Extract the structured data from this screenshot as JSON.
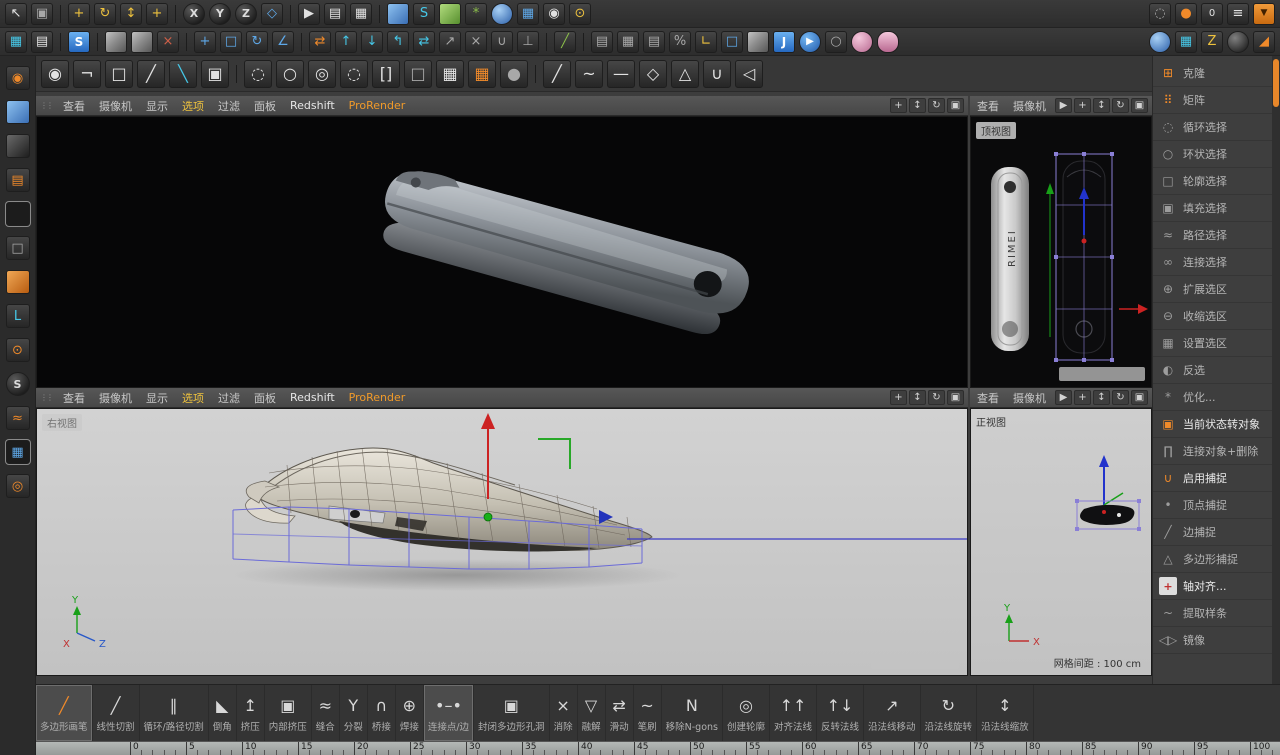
{
  "colors": {
    "accent_orange": "#e8872a",
    "menu_highlight": "#eec23e",
    "prorender_orange": "#f09a2a",
    "cage_purple": "#8a7fd6",
    "axis_red": "#cc2222",
    "axis_green": "#18a018",
    "axis_blue": "#2233cc"
  },
  "toolbars": {
    "row1": [
      {
        "n": "live-selection-icon",
        "g": "↖",
        "c": "i-light"
      },
      {
        "n": "snapshot-icon",
        "g": "▣",
        "c": "i-gray"
      },
      {
        "s": 1
      },
      {
        "n": "move-tool-icon",
        "g": "+",
        "c": "i-yellow"
      },
      {
        "n": "rotate-tool-icon",
        "g": "↻",
        "c": "i-yellow"
      },
      {
        "n": "scale-tool-icon",
        "g": "↕",
        "c": "i-yellow"
      },
      {
        "n": "last-tool-icon",
        "g": "+",
        "c": "i-yellow"
      },
      {
        "s": 1
      },
      {
        "n": "x-axis-lock-icon",
        "g": "X",
        "c": "i-darkcircle"
      },
      {
        "n": "y-axis-lock-icon",
        "g": "Y",
        "c": "i-darkcircle"
      },
      {
        "n": "z-axis-lock-icon",
        "g": "Z",
        "c": "i-darkcircle"
      },
      {
        "n": "coordinate-system-icon",
        "g": "◇",
        "c": "i-blue"
      },
      {
        "s": 1
      },
      {
        "n": "render-view-icon",
        "g": "▶",
        "c": "i-light"
      },
      {
        "n": "render-region-icon",
        "g": "▤",
        "c": "i-light"
      },
      {
        "n": "render-settings-icon",
        "g": "▦",
        "c": "i-light"
      },
      {
        "s": 1
      },
      {
        "n": "new-material-icon",
        "c": "i-cube-blue"
      },
      {
        "n": "spline-pen-icon",
        "g": "S",
        "c": "i-cyan"
      },
      {
        "n": "surface-pen-icon",
        "c": "i-cube-green"
      },
      {
        "n": "array-object-icon",
        "g": "*",
        "c": "i-green"
      },
      {
        "n": "figure-object-icon",
        "c": "i-sphere-blue"
      },
      {
        "n": "volume-builder-icon",
        "g": "▦",
        "c": "i-blue"
      },
      {
        "n": "camera-object-icon",
        "g": "◉",
        "c": "i-light"
      },
      {
        "n": "light-object-icon",
        "g": "⊙",
        "c": "i-yellow"
      }
    ],
    "row1_right": [
      {
        "n": "interactive-region-icon",
        "g": "◌",
        "c": "i-gray"
      },
      {
        "n": "team-render-icon",
        "g": "●",
        "c": "i-orange"
      },
      {
        "n": "frame-counter",
        "g": "0",
        "c": "i-light i-spin"
      },
      {
        "n": "layer-list-icon",
        "g": "≡",
        "c": "i-light"
      },
      {
        "n": "quick-access-icon",
        "g": "▼",
        "c": "i-orangebg"
      }
    ],
    "row2": [
      {
        "n": "content-browser-icon",
        "g": "▦",
        "c": "i-cyan"
      },
      {
        "n": "console-icon",
        "g": "▤",
        "c": "i-light"
      },
      {
        "s": 1
      },
      {
        "n": "s-plugin-icon",
        "g": "S",
        "c": "i-bluebadge"
      },
      {
        "s": 1
      },
      {
        "n": "cube-object-icon",
        "c": "i-cube-gray"
      },
      {
        "n": "instance-object-icon",
        "c": "i-cube-gray"
      },
      {
        "n": "delete-icon",
        "g": "×",
        "c": "i-red"
      },
      {
        "s": 1
      },
      {
        "n": "move-frame-icon",
        "g": "+",
        "c": "i-blue"
      },
      {
        "n": "frame-selected-icon",
        "g": "□",
        "c": "i-blue"
      },
      {
        "n": "rotate-view-icon",
        "g": "↻",
        "c": "i-blue"
      },
      {
        "n": "protractor-icon",
        "g": "∠",
        "c": "i-blue"
      },
      {
        "s": 1
      },
      {
        "n": "swap-axis-icon",
        "g": "⇄",
        "c": "i-orange"
      },
      {
        "n": "arrange-up-icon",
        "g": "↑",
        "c": "i-cyan"
      },
      {
        "n": "arrange-down-icon",
        "g": "↓",
        "c": "i-cyan"
      },
      {
        "n": "transfer-icon",
        "g": "↰",
        "c": "i-cyan"
      },
      {
        "n": "arrow-pair-icon",
        "g": "⇄",
        "c": "i-cyan"
      },
      {
        "n": "arrow-ne-icon",
        "g": "↗",
        "c": "i-gray"
      },
      {
        "n": "arrow-cross-icon",
        "g": "×",
        "c": "i-gray"
      },
      {
        "n": "snap-small-icon",
        "g": "∪",
        "c": "i-gray"
      },
      {
        "n": "axis-swap-icon",
        "g": "⊥",
        "c": "i-gray"
      },
      {
        "s": 1
      },
      {
        "n": "knife-small-icon",
        "g": "╱",
        "c": "i-green"
      },
      {
        "s": 1
      },
      {
        "n": "layer-a-icon",
        "g": "▤",
        "c": "i-gray"
      },
      {
        "n": "layer-b-icon",
        "g": "▦",
        "c": "i-gray"
      },
      {
        "n": "layer-c-icon",
        "g": "▤",
        "c": "i-gray"
      },
      {
        "n": "percent-icon",
        "g": "%",
        "c": "i-gray"
      },
      {
        "n": "workplane-icon",
        "g": "∟",
        "c": "i-yellow"
      },
      {
        "n": "frame-box-icon",
        "g": "□",
        "c": "i-blue"
      },
      {
        "n": "cube-small-icon",
        "c": "i-cube-gray"
      },
      {
        "n": "jump-icon",
        "g": "J",
        "c": "i-bluebadge"
      },
      {
        "n": "play-icon",
        "g": "▶",
        "c": "i-bluecircle"
      },
      {
        "n": "circle-null-icon",
        "g": "○",
        "c": "i-gray"
      },
      {
        "n": "sphere-pink-icon",
        "c": "i-sphere-pink"
      },
      {
        "n": "capsule-pink-icon",
        "c": "i-capsule-pink"
      }
    ],
    "row2_right": [
      {
        "n": "half-sphere-icon",
        "c": "i-sphere-blue"
      },
      {
        "n": "teal-grid-icon",
        "g": "▦",
        "c": "i-cyan"
      },
      {
        "n": "flash-z-icon",
        "g": "Z",
        "c": "i-yellow"
      },
      {
        "n": "dark-sphere-icon",
        "c": "i-sphere-dark"
      },
      {
        "n": "orange-wedge-icon",
        "g": "◢",
        "c": "i-orange"
      }
    ],
    "row3": [
      {
        "n": "sphere-brush-icon",
        "g": "◉",
        "c": "i-light"
      },
      {
        "n": "hook-tool-icon",
        "g": "¬",
        "c": "i-light"
      },
      {
        "n": "ghost-cube-icon",
        "g": "□",
        "c": "i-light"
      },
      {
        "n": "knife-tool-icon",
        "g": "╱",
        "c": "i-light"
      },
      {
        "n": "pen-tool-icon",
        "g": "╲",
        "c": "i-cyan"
      },
      {
        "n": "scale-cube-icon",
        "g": "▣",
        "c": "i-light"
      },
      {
        "s": 1
      },
      {
        "n": "point-mode-icon",
        "g": "◌",
        "c": "i-light"
      },
      {
        "n": "edge-mode-icon",
        "g": "○",
        "c": "i-light"
      },
      {
        "n": "polygon-mode-icon",
        "g": "◎",
        "c": "i-light"
      },
      {
        "n": "ring-points-icon",
        "g": "◌",
        "c": "i-light"
      },
      {
        "n": "bracket-select-icon",
        "g": "[]",
        "c": "i-light"
      },
      {
        "n": "dotted-box-icon",
        "g": "□",
        "c": "i-gray"
      },
      {
        "n": "grid-select-icon",
        "g": "▦",
        "c": "i-light"
      },
      {
        "n": "grid-uv-icon",
        "g": "▦",
        "c": "i-orange"
      },
      {
        "n": "point-sphere-icon",
        "g": "●",
        "c": "i-gray"
      },
      {
        "s": 1
      },
      {
        "n": "brush-tool-icon",
        "g": "╱",
        "c": "i-light"
      },
      {
        "n": "smooth-tool-icon",
        "g": "~",
        "c": "i-light"
      },
      {
        "n": "cut-tool-icon",
        "g": "—",
        "c": "i-light"
      },
      {
        "n": "cube-3d-icon",
        "g": "◇",
        "c": "i-light"
      },
      {
        "n": "group-tool-icon",
        "g": "△",
        "c": "i-light"
      },
      {
        "n": "magnet-tool-icon",
        "g": "∪",
        "c": "i-light"
      },
      {
        "n": "mirror-tool-icon",
        "g": "◁",
        "c": "i-light"
      }
    ]
  },
  "sidebar": {
    "items": [
      {
        "n": "browser-globe-icon",
        "g": "◉",
        "c": "i-orange"
      },
      {
        "n": "cube-blue-icon",
        "c": "i-cube-blue"
      },
      {
        "n": "cube-dark-icon",
        "c": "i-cube-dark"
      },
      {
        "n": "layers-icon",
        "g": "▤",
        "c": "i-orange"
      },
      {
        "n": "cube-green-icon",
        "c": "i-cube-green",
        "a": 1
      },
      {
        "n": "cube-outline-icon",
        "g": "□",
        "c": "i-gray"
      },
      {
        "n": "cube-orange-icon",
        "c": "i-cube-orange"
      },
      {
        "n": "spline-corner-icon",
        "g": "L",
        "c": "i-cyan"
      },
      {
        "n": "mouse-icon",
        "g": "⊙",
        "c": "i-orange"
      },
      {
        "n": "sculpt-s-icon",
        "g": "S",
        "c": "i-darkcircle"
      },
      {
        "n": "deform-icon",
        "g": "≈",
        "c": "i-orange"
      },
      {
        "n": "array-grid-icon",
        "g": "▦",
        "c": "i-blue",
        "a": 1
      },
      {
        "n": "torus-icon",
        "g": "◎",
        "c": "i-orange"
      }
    ]
  },
  "menus": {
    "main": [
      {
        "t": "查看"
      },
      {
        "t": "摄像机"
      },
      {
        "t": "显示"
      },
      {
        "t": "选项",
        "cls": "m-sel"
      },
      {
        "t": "过滤"
      },
      {
        "t": "面板"
      },
      {
        "t": "Redshift",
        "cls": "m-rs"
      },
      {
        "t": "ProRender",
        "cls": "m-pr"
      }
    ],
    "side": [
      {
        "t": "查看"
      },
      {
        "t": "摄像机"
      }
    ],
    "expander": "▶",
    "nav_icons": [
      {
        "n": "pan-view-icon",
        "g": "+"
      },
      {
        "n": "zoom-view-icon",
        "g": "↕"
      },
      {
        "n": "rotate-view-icon",
        "g": "↻"
      },
      {
        "n": "toggle-view-icon",
        "g": "▣"
      }
    ]
  },
  "viewports": {
    "right_view": {
      "label": "右视图"
    },
    "top_right": {
      "label": "顶视图",
      "brand": "RIMEI"
    },
    "bottom_right": {
      "label": "正视图",
      "grid_status": "网格间距 : 100 cm"
    }
  },
  "axes": {
    "x": "X",
    "y": "Y",
    "z": "Z"
  },
  "right_panel": {
    "items": [
      {
        "label": "克隆",
        "glyph": "⊞",
        "color": "orange"
      },
      {
        "label": "矩阵",
        "glyph": "⠿",
        "color": "orange"
      },
      {
        "label": "循环选择",
        "glyph": "◌",
        "color": "gray"
      },
      {
        "label": "环状选择",
        "glyph": "○",
        "color": "gray"
      },
      {
        "label": "轮廓选择",
        "glyph": "□",
        "color": "gray"
      },
      {
        "label": "填充选择",
        "glyph": "▣",
        "color": "gray"
      },
      {
        "label": "路径选择",
        "glyph": "≈",
        "color": "gray"
      },
      {
        "label": "连接选择",
        "glyph": "∞",
        "color": "gray"
      },
      {
        "label": "扩展选区",
        "glyph": "⊕",
        "color": "gray"
      },
      {
        "label": "收缩选区",
        "glyph": "⊖",
        "color": "gray"
      },
      {
        "label": "设置选区",
        "glyph": "▦",
        "color": "gray"
      },
      {
        "label": "反选",
        "glyph": "◐",
        "color": "gray"
      },
      {
        "label": "优化...",
        "glyph": "*",
        "color": "gray"
      },
      {
        "label": "当前状态转对象",
        "glyph": "▣",
        "color": "orange",
        "bright": true
      },
      {
        "label": "连接对象+删除",
        "glyph": "∏",
        "color": "gray"
      },
      {
        "label": "启用捕捉",
        "glyph": "∪",
        "color": "orange",
        "bright": true
      },
      {
        "label": "顶点捕捉",
        "glyph": "•",
        "color": "gray"
      },
      {
        "label": "边捕捉",
        "glyph": "╱",
        "color": "gray"
      },
      {
        "label": "多边形捕捉",
        "glyph": "△",
        "color": "gray"
      },
      {
        "label": "轴对齐...",
        "glyph": "+",
        "color": "boxed",
        "bright": true
      },
      {
        "label": "提取样条",
        "glyph": "~",
        "color": "gray"
      },
      {
        "label": "镜像",
        "glyph": "◁▷",
        "color": "gray"
      }
    ]
  },
  "bottom_toolbar": {
    "items": [
      {
        "label": "多边形画笔",
        "glyph": "╱",
        "active": true
      },
      {
        "label": "线性切割",
        "glyph": "╱"
      },
      {
        "label": "循环/路径切割",
        "glyph": "∥"
      },
      {
        "label": "倒角",
        "glyph": "◣"
      },
      {
        "label": "挤压",
        "glyph": "↥"
      },
      {
        "label": "内部挤压",
        "glyph": "▣"
      },
      {
        "label": "缝合",
        "glyph": "≈"
      },
      {
        "label": "分裂",
        "glyph": "Y"
      },
      {
        "label": "桥接",
        "glyph": "∩"
      },
      {
        "label": "焊接",
        "glyph": "⊕"
      },
      {
        "label": "连接点/边",
        "glyph": "•–•",
        "active": true
      },
      {
        "label": "封闭多边形孔洞",
        "glyph": "▣"
      },
      {
        "label": "消除",
        "glyph": "×"
      },
      {
        "label": "融解",
        "glyph": "▽"
      },
      {
        "label": "滑动",
        "glyph": "⇄"
      },
      {
        "label": "笔刷",
        "glyph": "~"
      },
      {
        "label": "移除N-gons",
        "glyph": "N"
      },
      {
        "label": "创建轮廓",
        "glyph": "◎"
      },
      {
        "label": "对齐法线",
        "glyph": "↑↑"
      },
      {
        "label": "反转法线",
        "glyph": "↑↓"
      },
      {
        "label": "沿法线移动",
        "glyph": "↗"
      },
      {
        "label": "沿法线旋转",
        "glyph": "↻"
      },
      {
        "label": "沿法线缩放",
        "glyph": "↕"
      }
    ]
  },
  "ruler": {
    "origin": 94,
    "step": 56,
    "labels": [
      "0",
      "5",
      "10",
      "15",
      "20",
      "25",
      "30",
      "35",
      "40",
      "45",
      "50",
      "55",
      "60",
      "65",
      "70",
      "75",
      "80",
      "85",
      "90",
      "95",
      "100"
    ]
  }
}
